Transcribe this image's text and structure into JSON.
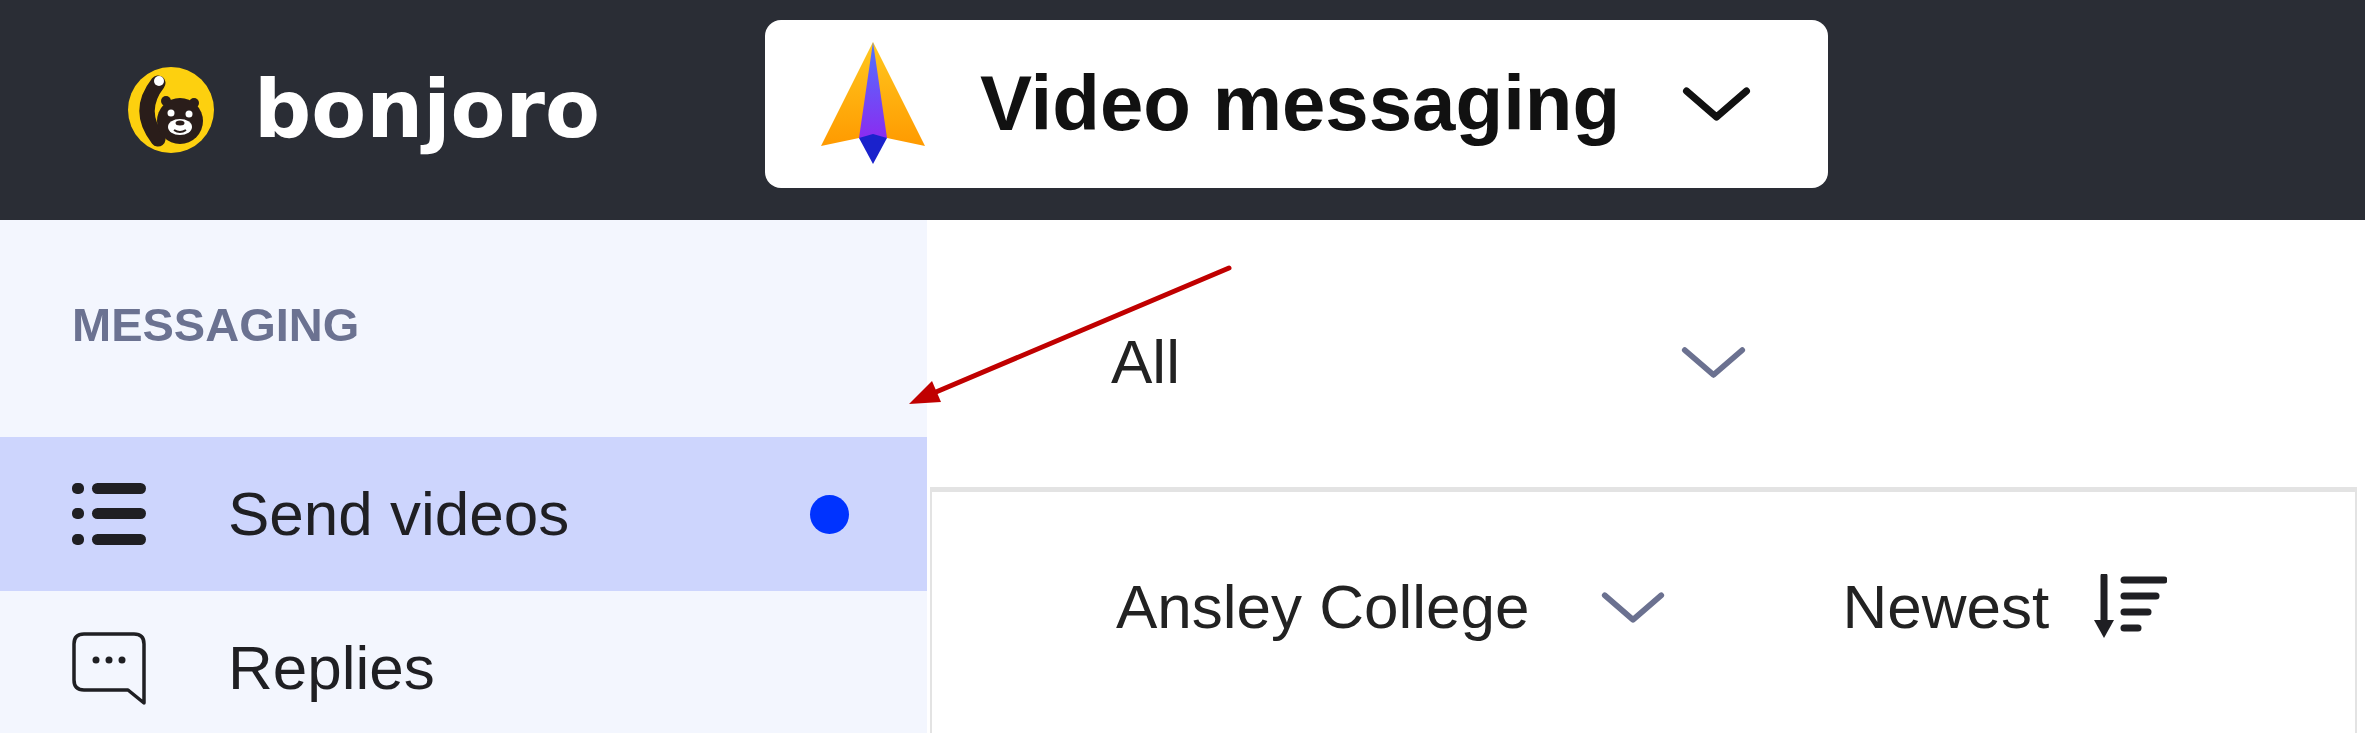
{
  "header": {
    "logo": {
      "text": "bonjoro"
    },
    "product_switcher": {
      "label": "Video messaging"
    }
  },
  "sidebar": {
    "section_title": "MESSAGING",
    "items": [
      {
        "kind": "list",
        "label": "Send videos",
        "selected": true,
        "unread": true
      },
      {
        "kind": "chat",
        "label": "Replies",
        "selected": false,
        "unread": false
      }
    ]
  },
  "main": {
    "filter": {
      "value": "All"
    },
    "toolbar": {
      "group": {
        "value": "Ansley College"
      },
      "sort": {
        "label": "Newest"
      }
    }
  }
}
